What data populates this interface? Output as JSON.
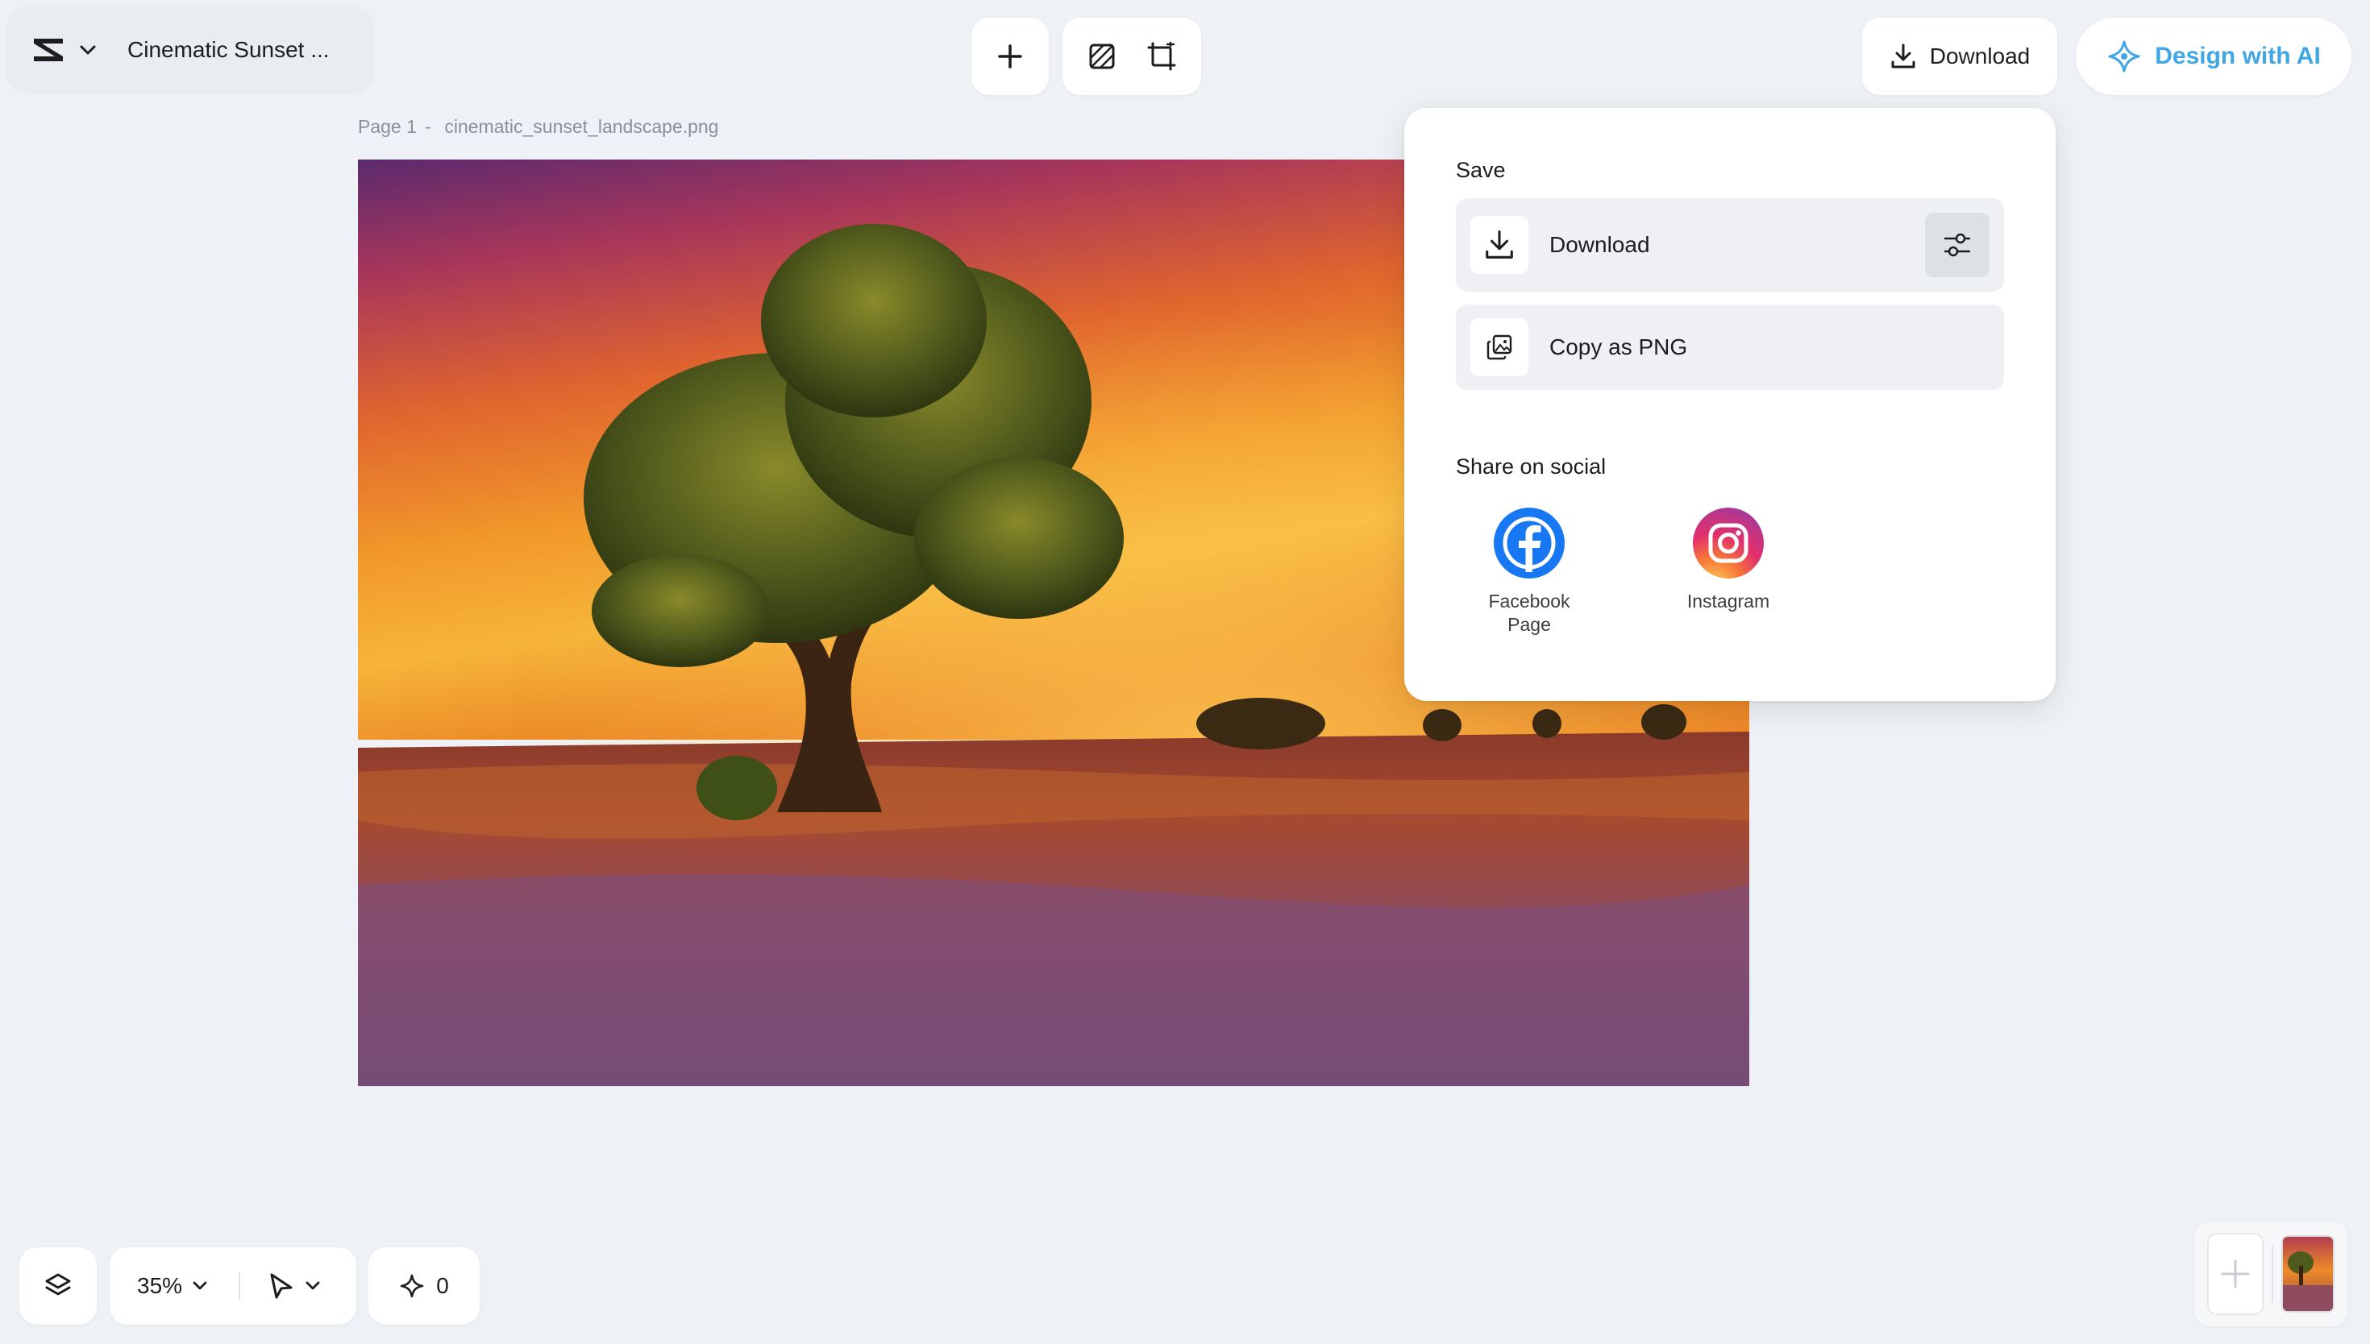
{
  "header": {
    "project_title": "Cinematic Sunset ...",
    "download_label": "Download",
    "design_ai_label": "Design with AI"
  },
  "canvas": {
    "page_label": "Page 1",
    "page_separator": "-",
    "file_name": "cinematic_sunset_landscape.png"
  },
  "download_menu": {
    "save_heading": "Save",
    "download_label": "Download",
    "copy_label": "Copy as PNG",
    "share_heading": "Share on social",
    "social": [
      {
        "label": "Facebook Page",
        "icon": "facebook-icon"
      },
      {
        "label": "Instagram",
        "icon": "instagram-icon"
      }
    ]
  },
  "bottom_bar": {
    "zoom_level": "35%",
    "ai_credits": "0"
  },
  "colors": {
    "background": "#eef1f5",
    "accent_ai": "#3fa7e6",
    "facebook": "#1877f2"
  }
}
